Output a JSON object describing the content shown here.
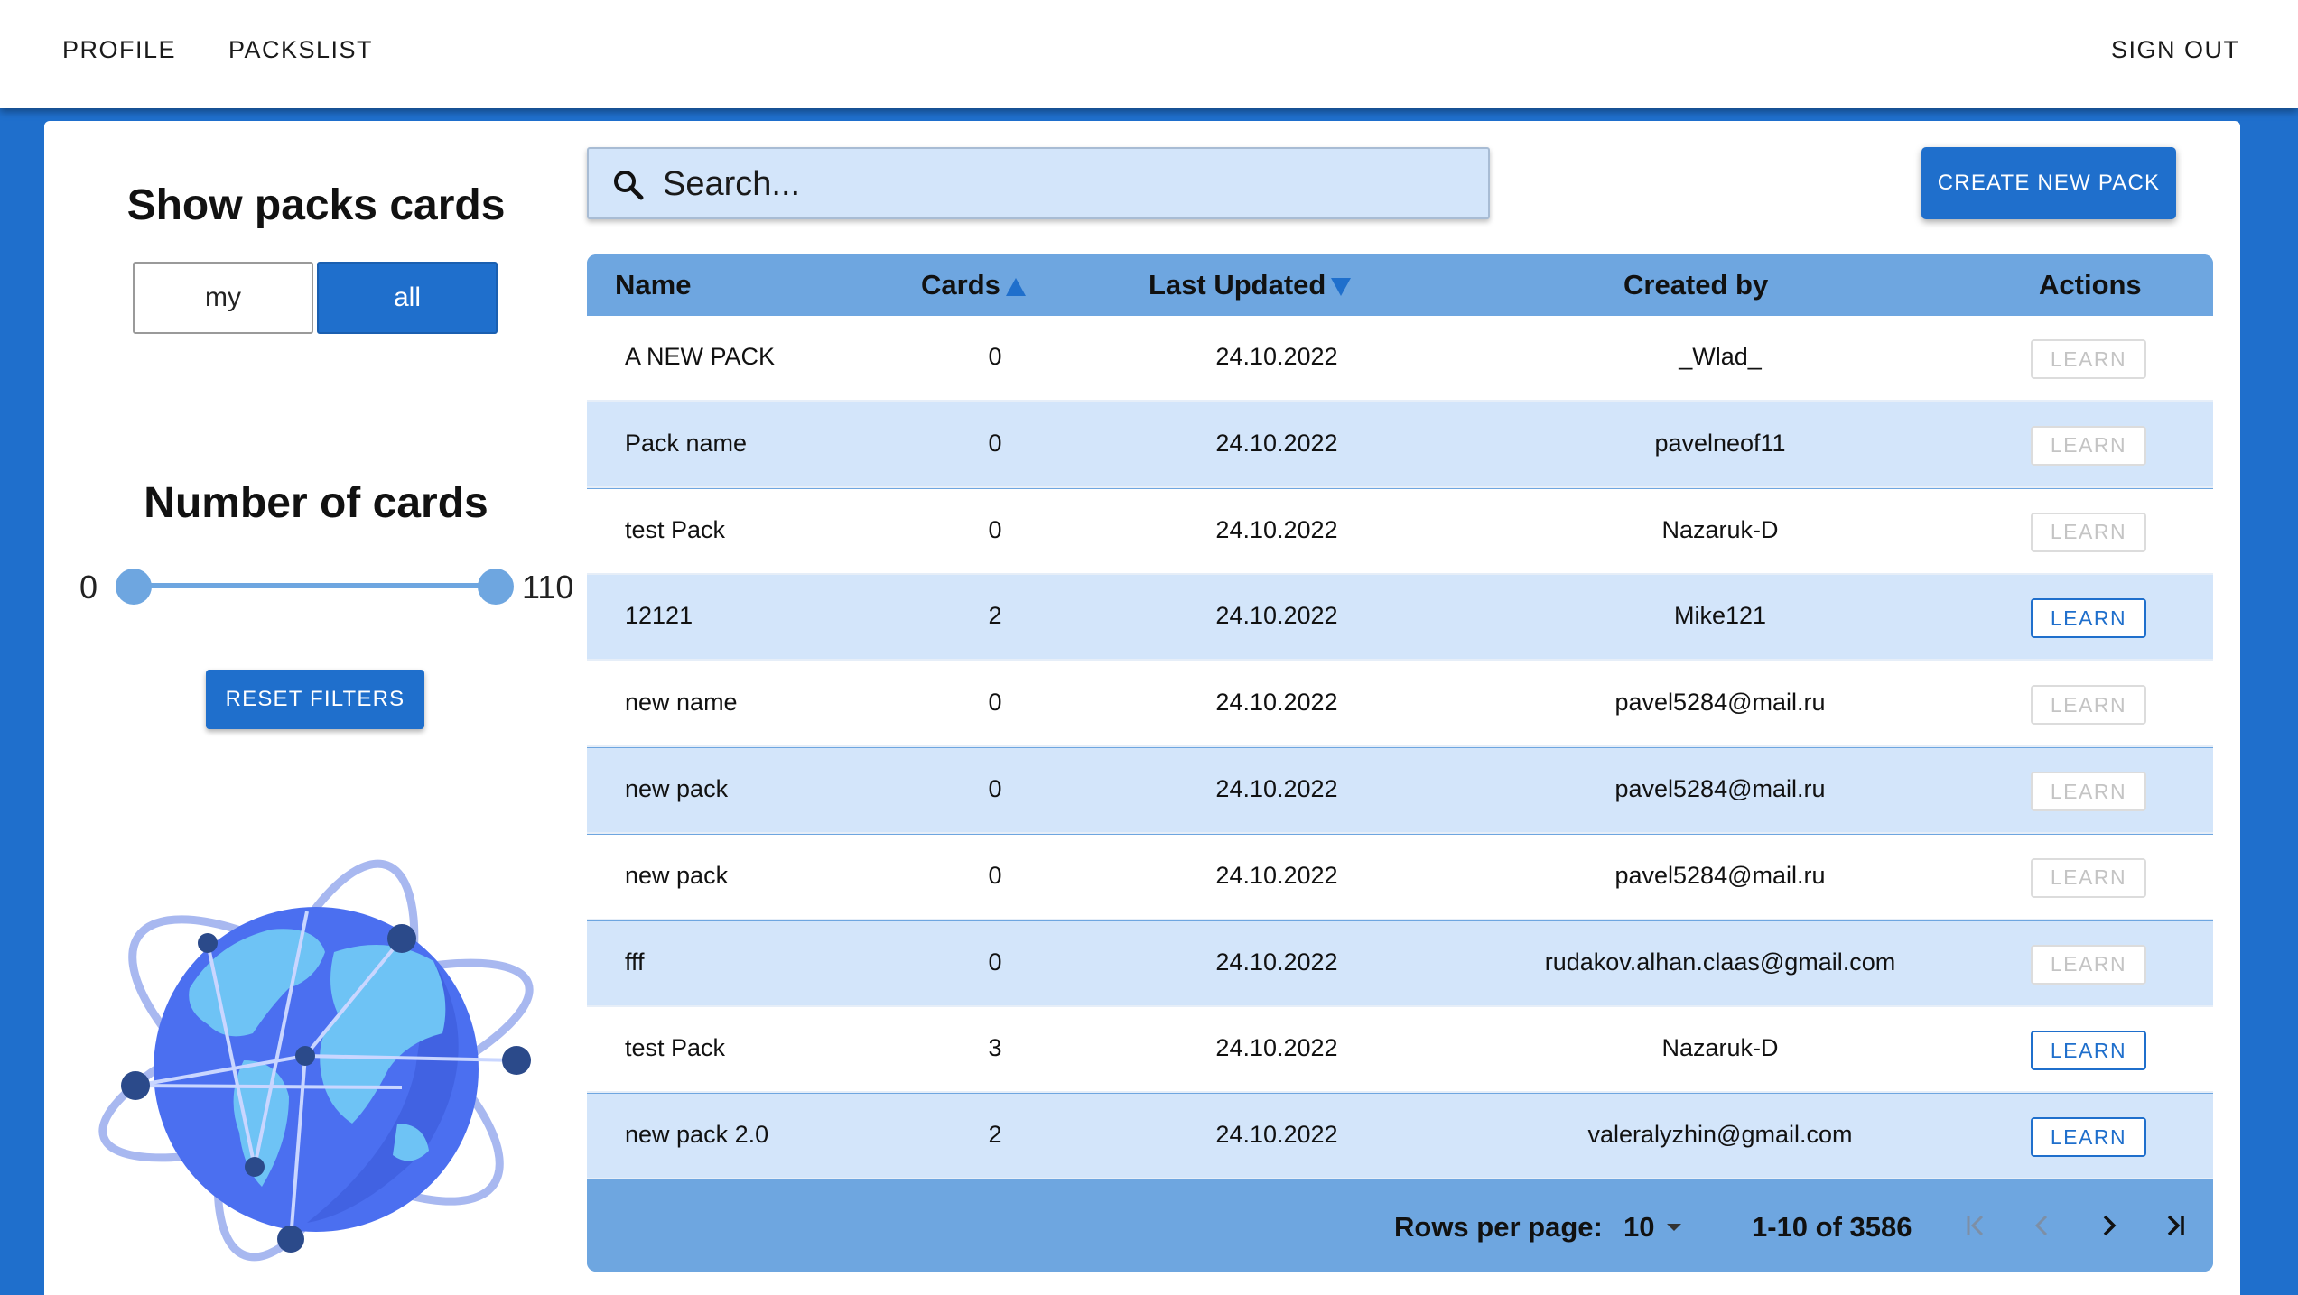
{
  "nav": {
    "profile": "PROFILE",
    "packslist": "PACKSLIST",
    "sign_out": "SIGN OUT"
  },
  "filters": {
    "show_title": "Show packs cards",
    "my_label": "my",
    "all_label": "all",
    "selected": "all",
    "number_title": "Number of cards",
    "min_value": "0",
    "max_value": "110",
    "reset_label": "RESET FILTERS"
  },
  "search": {
    "placeholder": "Search..."
  },
  "toolbar": {
    "create_label": "CREATE NEW PACK"
  },
  "table": {
    "headers": {
      "name": "Name",
      "cards": "Cards",
      "updated": "Last Updated",
      "creator": "Created by",
      "actions": "Actions"
    },
    "learn_label": "LEARN",
    "rows": [
      {
        "name": "A NEW PACK",
        "cards": "0",
        "updated": "24.10.2022",
        "creator": "_Wlad_",
        "learn_enabled": false
      },
      {
        "name": "Pack name",
        "cards": "0",
        "updated": "24.10.2022",
        "creator": "pavelneof11",
        "learn_enabled": false
      },
      {
        "name": "test Pack",
        "cards": "0",
        "updated": "24.10.2022",
        "creator": "Nazaruk-D",
        "learn_enabled": false
      },
      {
        "name": "12121",
        "cards": "2",
        "updated": "24.10.2022",
        "creator": "Mike121",
        "learn_enabled": true
      },
      {
        "name": "new name",
        "cards": "0",
        "updated": "24.10.2022",
        "creator": "pavel5284@mail.ru",
        "learn_enabled": false
      },
      {
        "name": "new pack",
        "cards": "0",
        "updated": "24.10.2022",
        "creator": "pavel5284@mail.ru",
        "learn_enabled": false
      },
      {
        "name": "new pack",
        "cards": "0",
        "updated": "24.10.2022",
        "creator": "pavel5284@mail.ru",
        "learn_enabled": false
      },
      {
        "name": "fff",
        "cards": "0",
        "updated": "24.10.2022",
        "creator": "rudakov.alhan.claas@gmail.com",
        "learn_enabled": false
      },
      {
        "name": "test Pack",
        "cards": "3",
        "updated": "24.10.2022",
        "creator": "Nazaruk-D",
        "learn_enabled": true
      },
      {
        "name": "new pack 2.0",
        "cards": "2",
        "updated": "24.10.2022",
        "creator": "valeralyzhin@gmail.com",
        "learn_enabled": true
      }
    ]
  },
  "pagination": {
    "rows_per_page_label": "Rows per page:",
    "rows_per_page": "10",
    "range": "1-10 of 3586"
  },
  "colors": {
    "primary": "#1f6fcc",
    "header_blue": "#6ea6e0",
    "row_alt": "#d3e5fa",
    "disabled": "#c4c4c4"
  },
  "icons": [
    "search-icon",
    "sort-asc-icon",
    "sort-desc-icon",
    "first-page-icon",
    "prev-page-icon",
    "next-page-icon",
    "last-page-icon",
    "globe-illustration"
  ]
}
